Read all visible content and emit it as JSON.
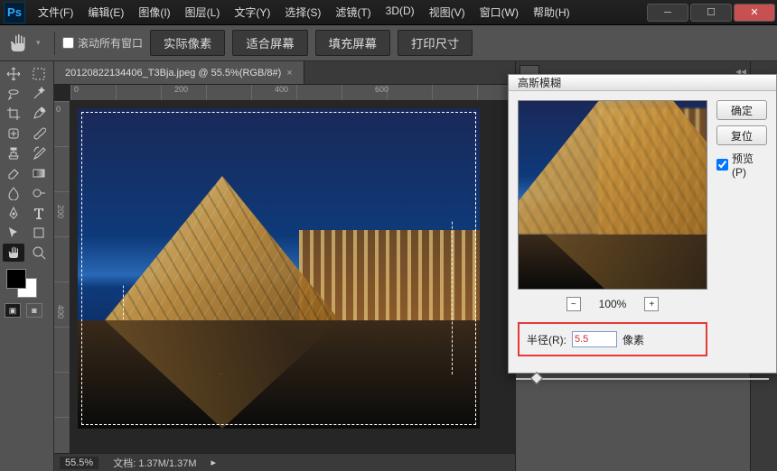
{
  "menus": {
    "file": "文件(F)",
    "edit": "编辑(E)",
    "image": "图像(I)",
    "layer": "图层(L)",
    "type": "文字(Y)",
    "select": "选择(S)",
    "filter": "滤镜(T)",
    "threed": "3D(D)",
    "view": "视图(V)",
    "window": "窗口(W)",
    "help": "帮助(H)"
  },
  "optbar": {
    "scroll_all": "滚动所有窗口",
    "actual_pixels": "实际像素",
    "fit_screen": "适合屏幕",
    "fill_screen": "填充屏幕",
    "print_size": "打印尺寸"
  },
  "tab": {
    "name": "20120822134406_T3Bja.jpeg @ 55.5%(RGB/8#)",
    "close": "×"
  },
  "ruler_h": [
    "0",
    "200",
    "400",
    "600"
  ],
  "ruler_v": [
    "0",
    "200",
    "400"
  ],
  "status": {
    "zoom": "55.5%",
    "doc_label": "文档:",
    "doc_size": "1.37M/1.37M"
  },
  "dialog": {
    "title": "高斯模糊",
    "ok": "确定",
    "reset": "复位",
    "preview": "预览(P)",
    "preview_checked": true,
    "zoom_pct": "100%",
    "radius_label": "半径(R):",
    "radius_value": "5.5",
    "radius_unit": "像素"
  },
  "icons": {
    "hand": "✋",
    "minus": "−",
    "plus": "+",
    "caret": "▾"
  }
}
